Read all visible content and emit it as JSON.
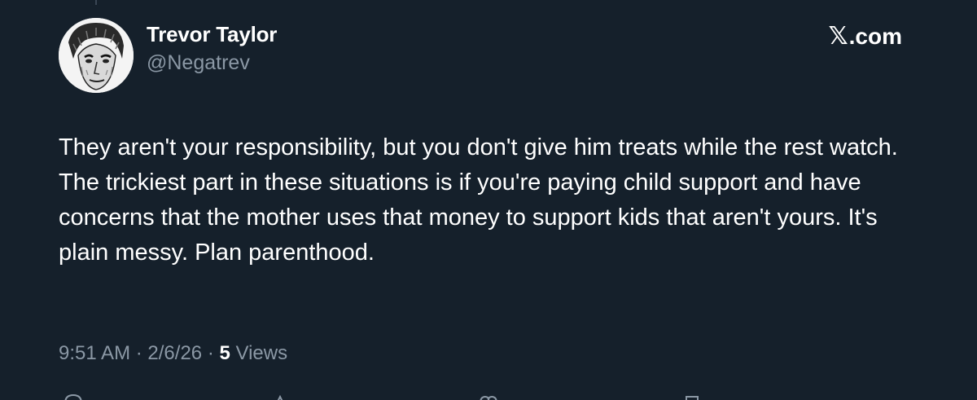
{
  "author": {
    "display_name": "Trevor Taylor",
    "handle": "@Negatrev",
    "avatar_icon": "avatar-sketch-portrait"
  },
  "brand": {
    "x_glyph": "𝕏",
    "domain": ".com"
  },
  "post": {
    "lines": [
      "They aren't your responsibility, but you don't give him treats while the rest watch.",
      "The trickiest part in these situations is if you're paying child support and have concerns that the mother uses that money to support kids that aren't yours. It's plain messy. Plan parenthood."
    ]
  },
  "meta": {
    "time": "9:51 AM",
    "separator": "·",
    "date": "2/6/26",
    "views_count": "5",
    "views_label": "Views"
  },
  "actions": [
    "reply-icon",
    "repost-icon",
    "like-icon",
    "bookmark-icon"
  ],
  "colors": {
    "background": "#15202b",
    "primary_text": "#ffffff",
    "secondary_text": "#8b98a5"
  }
}
